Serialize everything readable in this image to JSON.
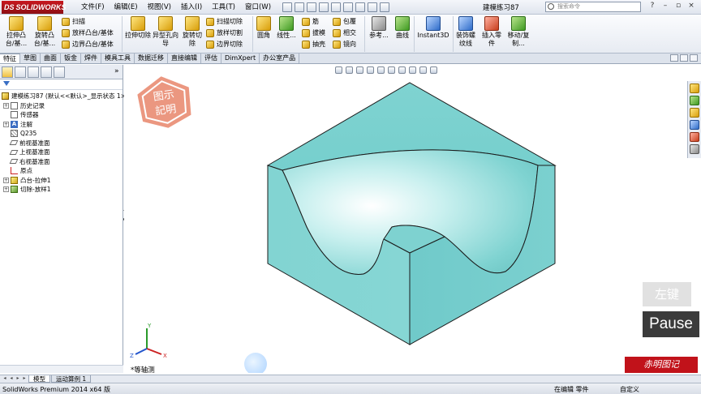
{
  "app": {
    "logo_text": "SOLIDWORKS",
    "logo_prefix": "DS",
    "document_title": "建模练习87",
    "search_placeholder": "搜索命令"
  },
  "menu": [
    "文件(F)",
    "编辑(E)",
    "视图(V)",
    "插入(I)",
    "工具(T)",
    "窗口(W)"
  ],
  "ribbon": {
    "extrude_boss": "拉伸凸台/基...",
    "revolve_boss": "旋转凸台/基...",
    "sweep": "扫描",
    "loft_boss": "放样凸台/基体",
    "boundary_boss": "边界凸台/基体",
    "extrude_cut": "拉伸切除",
    "hole_wizard": "异型孔向导",
    "revolve_cut": "旋转切除",
    "swept_cut": "扫描切除",
    "lofted_cut": "放样切割",
    "boundary_cut": "边界切除",
    "fillet": "圆角",
    "linear_pattern": "线性...",
    "rib": "筋",
    "draft": "拔模",
    "shell": "抽壳",
    "wrap": "包覆",
    "intersect": "相交",
    "mirror": "镜向",
    "reference": "参考...",
    "curves": "曲线",
    "instant3d": "Instant3D",
    "cosmetic_thread": "装饰螺纹线",
    "insert_part": "插入零件",
    "move_copy": "移动/复制..."
  },
  "tabs": [
    "特征",
    "草图",
    "曲面",
    "钣金",
    "焊件",
    "模具工具",
    "数据迁移",
    "直接编辑",
    "评估",
    "DimXpert",
    "办公室产品"
  ],
  "tree": {
    "root": "建模练习87  (默认<<默认>_显示状态 1>)",
    "items": [
      {
        "label": "历史记录",
        "icon": "history-icon",
        "expand": "+"
      },
      {
        "label": "传感器",
        "icon": "sensor-icon",
        "expand": ""
      },
      {
        "label": "注解",
        "icon": "annotation-icon",
        "expand": "+"
      },
      {
        "label": "Q235",
        "icon": "material-icon",
        "expand": ""
      },
      {
        "label": "前视基准面",
        "icon": "plane-icon",
        "expand": ""
      },
      {
        "label": "上视基准面",
        "icon": "plane-icon",
        "expand": ""
      },
      {
        "label": "右视基准面",
        "icon": "plane-icon",
        "expand": ""
      },
      {
        "label": "原点",
        "icon": "origin-icon",
        "expand": ""
      },
      {
        "label": "凸台-拉伸1",
        "icon": "extrude-feature-icon",
        "expand": "+"
      },
      {
        "label": "切除-放样1",
        "icon": "cut-loft-feature-icon",
        "expand": "+"
      }
    ]
  },
  "graphics": {
    "view_name": "*等轴测",
    "stamp_line1": "图示",
    "stamp_line2": "記明",
    "triad": {
      "x": "X",
      "y": "Y",
      "z": "Z"
    }
  },
  "watermarks": {
    "key_hint": "左键",
    "pause": "Pause",
    "brand": "赤明图记"
  },
  "bottom_tabs": [
    "模型",
    "运动算例 1"
  ],
  "status": {
    "left": "SolidWorks Premium 2014 x64 版",
    "editing": "在编辑 零件",
    "custom": "自定义"
  },
  "colors": {
    "model_face": "#7fd3d1",
    "model_edge": "#1b1b1b",
    "ribbon_bg": "#eef1f6",
    "logo_red": "#c8181f"
  }
}
